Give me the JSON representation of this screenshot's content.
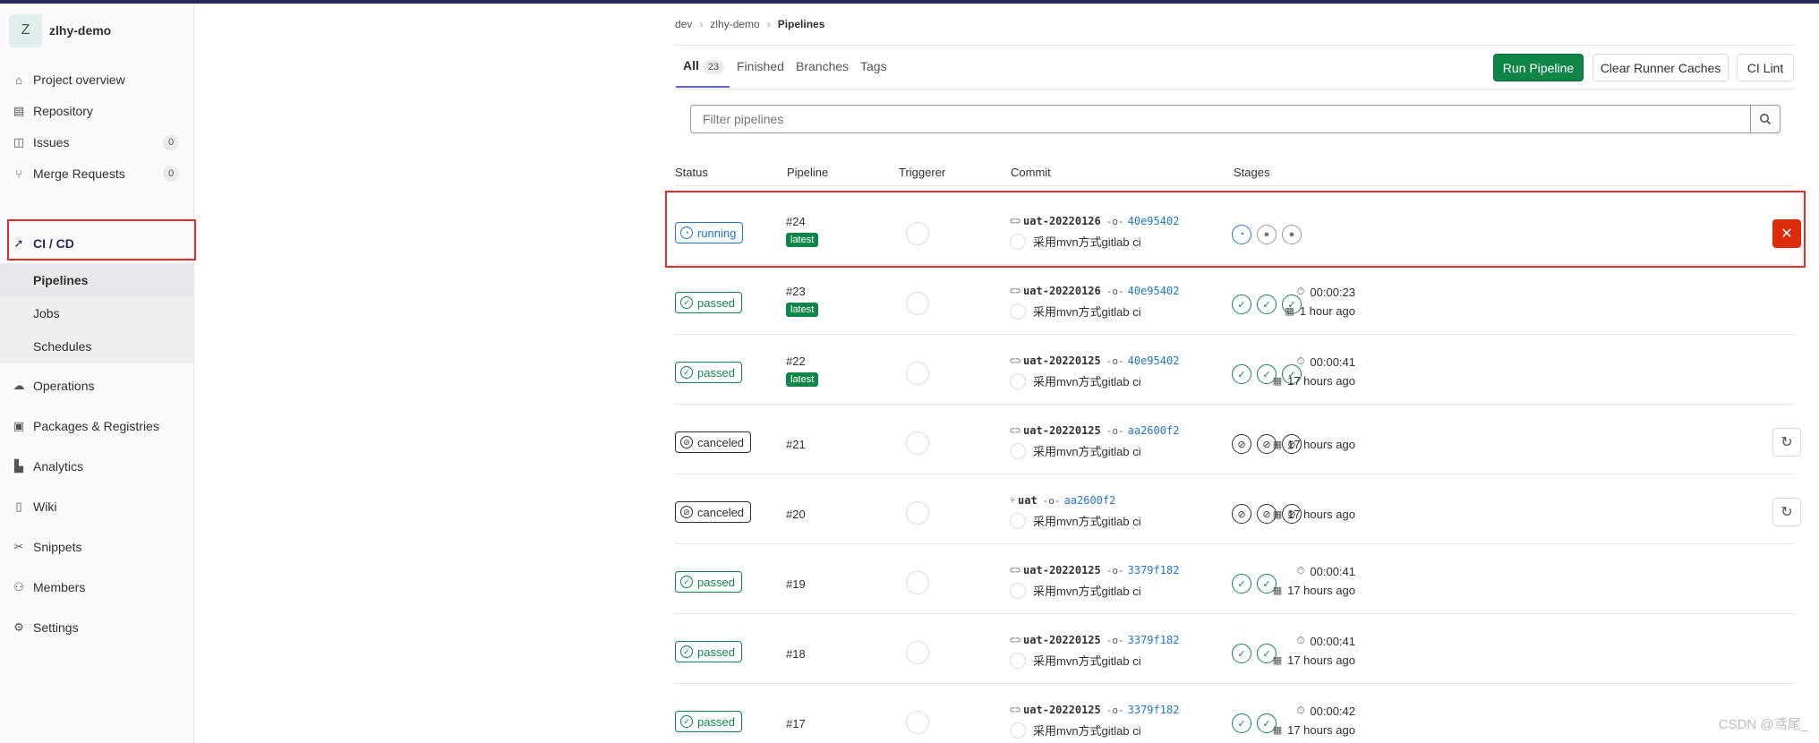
{
  "project": {
    "avatar": "Z",
    "name": "zlhy-demo"
  },
  "sidebar": {
    "items": [
      {
        "label": "Project overview",
        "icon": "home-icon"
      },
      {
        "label": "Repository",
        "icon": "doc-icon"
      },
      {
        "label": "Issues",
        "icon": "issues-icon",
        "count": "0"
      },
      {
        "label": "Merge Requests",
        "icon": "merge-request-icon",
        "count": "0"
      },
      {
        "label": "CI / CD",
        "icon": "rocket-icon"
      },
      {
        "label": "Operations",
        "icon": "cloud-gear-icon"
      },
      {
        "label": "Packages & Registries",
        "icon": "package-icon"
      },
      {
        "label": "Analytics",
        "icon": "chart-icon"
      },
      {
        "label": "Wiki",
        "icon": "book-icon"
      },
      {
        "label": "Snippets",
        "icon": "scissors-icon"
      },
      {
        "label": "Members",
        "icon": "users-icon"
      },
      {
        "label": "Settings",
        "icon": "gear-icon"
      }
    ],
    "subitems": [
      {
        "label": "Pipelines"
      },
      {
        "label": "Jobs"
      },
      {
        "label": "Schedules"
      }
    ]
  },
  "breadcrumb": {
    "group": "dev",
    "project": "zlhy-demo",
    "current": "Pipelines"
  },
  "tabs": [
    {
      "label": "All",
      "count": "23"
    },
    {
      "label": "Finished"
    },
    {
      "label": "Branches"
    },
    {
      "label": "Tags"
    }
  ],
  "buttons": {
    "run": "Run Pipeline",
    "clear": "Clear Runner Caches",
    "lint": "CI Lint"
  },
  "filter": {
    "placeholder": "Filter pipelines"
  },
  "columns": {
    "status": "Status",
    "pipeline": "Pipeline",
    "triggerer": "Triggerer",
    "commit": "Commit",
    "stages": "Stages"
  },
  "pipelines": [
    {
      "status": "running",
      "id": "#24",
      "badge": "latest",
      "ref": "uat-20220126",
      "sha": "40e95402",
      "message": "采用mvn方式gitlab ci",
      "duration": "",
      "finished": ""
    },
    {
      "status": "passed",
      "id": "#23",
      "badge": "latest",
      "ref": "uat-20220126",
      "sha": "40e95402",
      "message": "采用mvn方式gitlab ci",
      "duration": "00:00:23",
      "finished": "1 hour ago"
    },
    {
      "status": "passed",
      "id": "#22",
      "badge": "latest",
      "ref": "uat-20220125",
      "sha": "40e95402",
      "message": "采用mvn方式gitlab ci",
      "duration": "00:00:41",
      "finished": "17 hours ago"
    },
    {
      "status": "canceled",
      "id": "#21",
      "badge": "",
      "ref": "uat-20220125",
      "sha": "aa2600f2",
      "message": "采用mvn方式gitlab ci",
      "duration": "",
      "finished": "17 hours ago"
    },
    {
      "status": "canceled",
      "id": "#20",
      "badge": "",
      "ref": "uat",
      "sha": "aa2600f2",
      "message": "采用mvn方式gitlab ci",
      "duration": "",
      "finished": "17 hours ago"
    },
    {
      "status": "passed",
      "id": "#19",
      "badge": "",
      "ref": "uat-20220125",
      "sha": "3379f182",
      "message": "采用mvn方式gitlab ci",
      "duration": "00:00:41",
      "finished": "17 hours ago"
    },
    {
      "status": "passed",
      "id": "#18",
      "badge": "",
      "ref": "uat-20220125",
      "sha": "3379f182",
      "message": "采用mvn方式gitlab ci",
      "duration": "00:00:41",
      "finished": "17 hours ago"
    },
    {
      "status": "passed",
      "id": "#17",
      "badge": "",
      "ref": "uat-20220125",
      "sha": "3379f182",
      "message": "采用mvn方式gitlab ci",
      "duration": "00:00:42",
      "finished": "17 hours ago"
    }
  ],
  "watermark": "CSDN @鸢尾_",
  "colors": {
    "success": "#108548",
    "running": "#1f75cb",
    "danger": "#dd2b0e",
    "highlight": "#e32c2c",
    "nav": "#292961"
  }
}
